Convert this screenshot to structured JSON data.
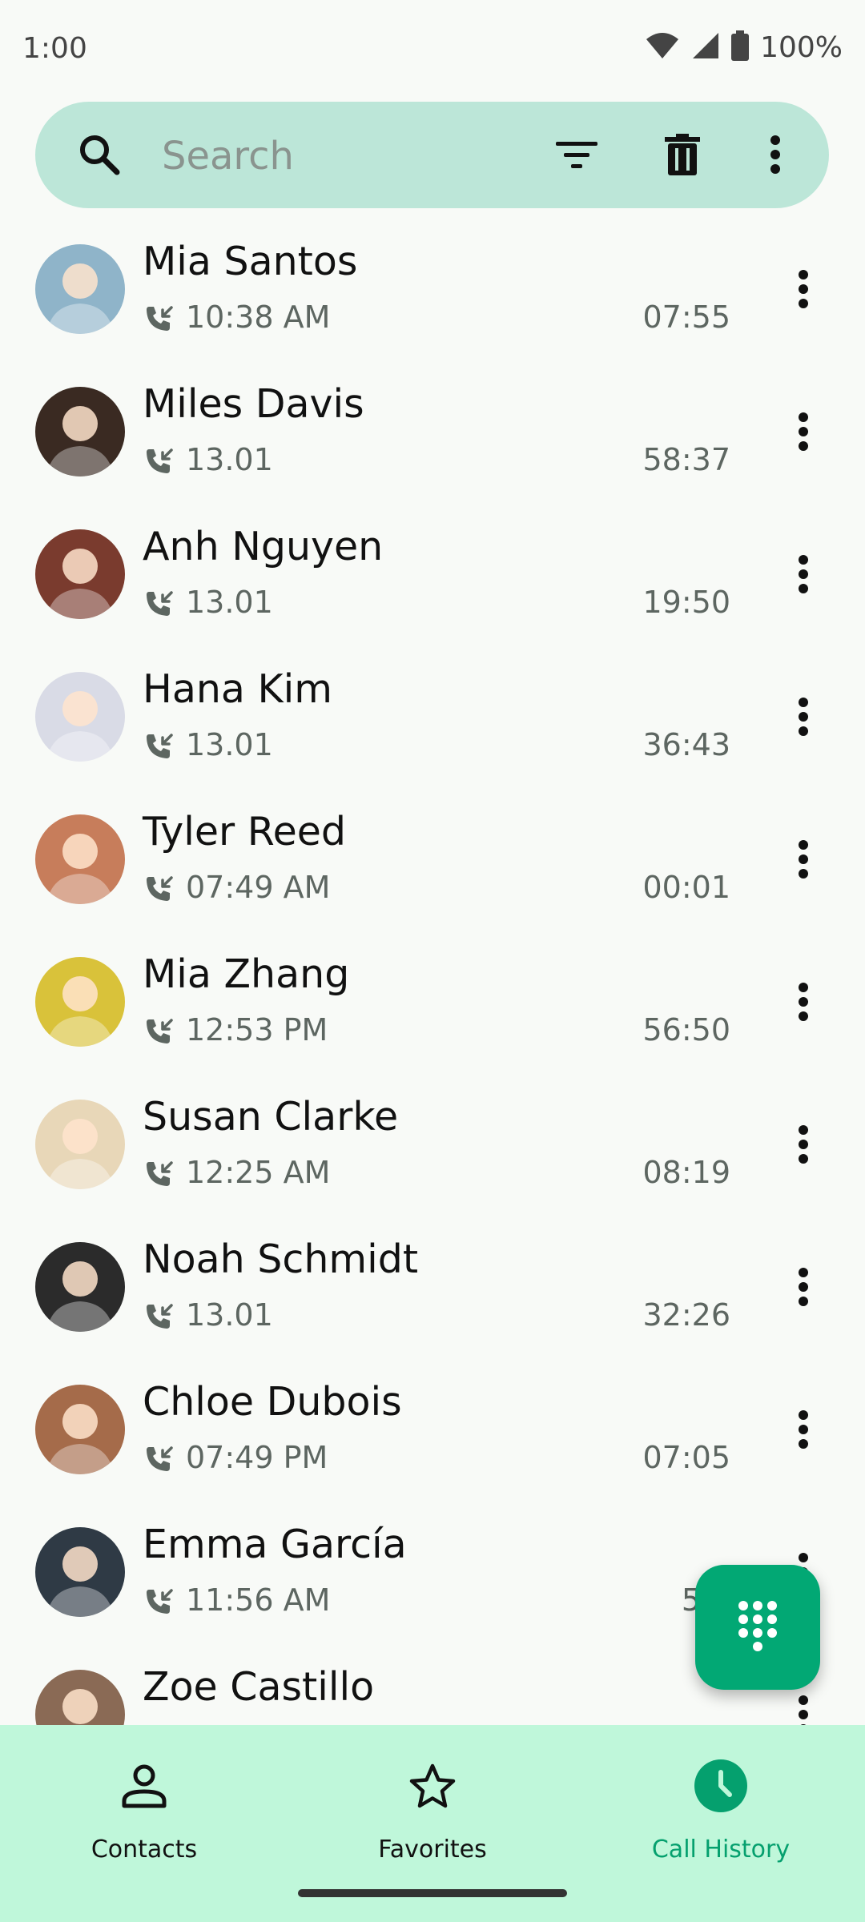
{
  "status_bar": {
    "time": "1:00",
    "battery": "100%",
    "icons": [
      "wifi-icon",
      "signal-icon",
      "battery-icon"
    ]
  },
  "search": {
    "placeholder": "Search",
    "icons": [
      "search-icon",
      "filter-icon",
      "delete-icon",
      "more-vert-icon"
    ]
  },
  "calls": [
    {
      "name": "Mia Santos",
      "time": "10:38 AM",
      "duration": "07:55",
      "avatar_color": "#8fb4c9"
    },
    {
      "name": "Miles Davis",
      "time": "13.01",
      "duration": "58:37",
      "avatar_color": "#3a2a22"
    },
    {
      "name": "Anh Nguyen",
      "time": "13.01",
      "duration": "19:50",
      "avatar_color": "#7a3b2e"
    },
    {
      "name": "Hana Kim",
      "time": "13.01",
      "duration": "36:43",
      "avatar_color": "#d9dbe6"
    },
    {
      "name": "Tyler Reed",
      "time": "07:49 AM",
      "duration": "00:01",
      "avatar_color": "#c77d5b"
    },
    {
      "name": "Mia Zhang",
      "time": "12:53 PM",
      "duration": "56:50",
      "avatar_color": "#d9c23a"
    },
    {
      "name": "Susan Clarke",
      "time": "12:25 AM",
      "duration": "08:19",
      "avatar_color": "#e8d7b8"
    },
    {
      "name": "Noah Schmidt",
      "time": "13.01",
      "duration": "32:26",
      "avatar_color": "#2b2b2b"
    },
    {
      "name": "Chloe Dubois",
      "time": "07:49 PM",
      "duration": "07:05",
      "avatar_color": "#a56b4a"
    },
    {
      "name": "Emma García",
      "time": "11:56 AM",
      "duration": "54:",
      "avatar_color": "#2f3a45"
    },
    {
      "name": "Zoe Castillo",
      "time": "",
      "duration": "",
      "avatar_color": "#8a6a55"
    }
  ],
  "fab": {
    "icon": "dialpad-icon",
    "color": "#02a874"
  },
  "nav": {
    "items": [
      {
        "label": "Contacts",
        "icon": "person-icon",
        "active": false
      },
      {
        "label": "Favorites",
        "icon": "star-icon",
        "active": false
      },
      {
        "label": "Call History",
        "icon": "clock-icon",
        "active": true
      }
    ],
    "background": "#bff7da",
    "active_color": "#05a06e"
  }
}
